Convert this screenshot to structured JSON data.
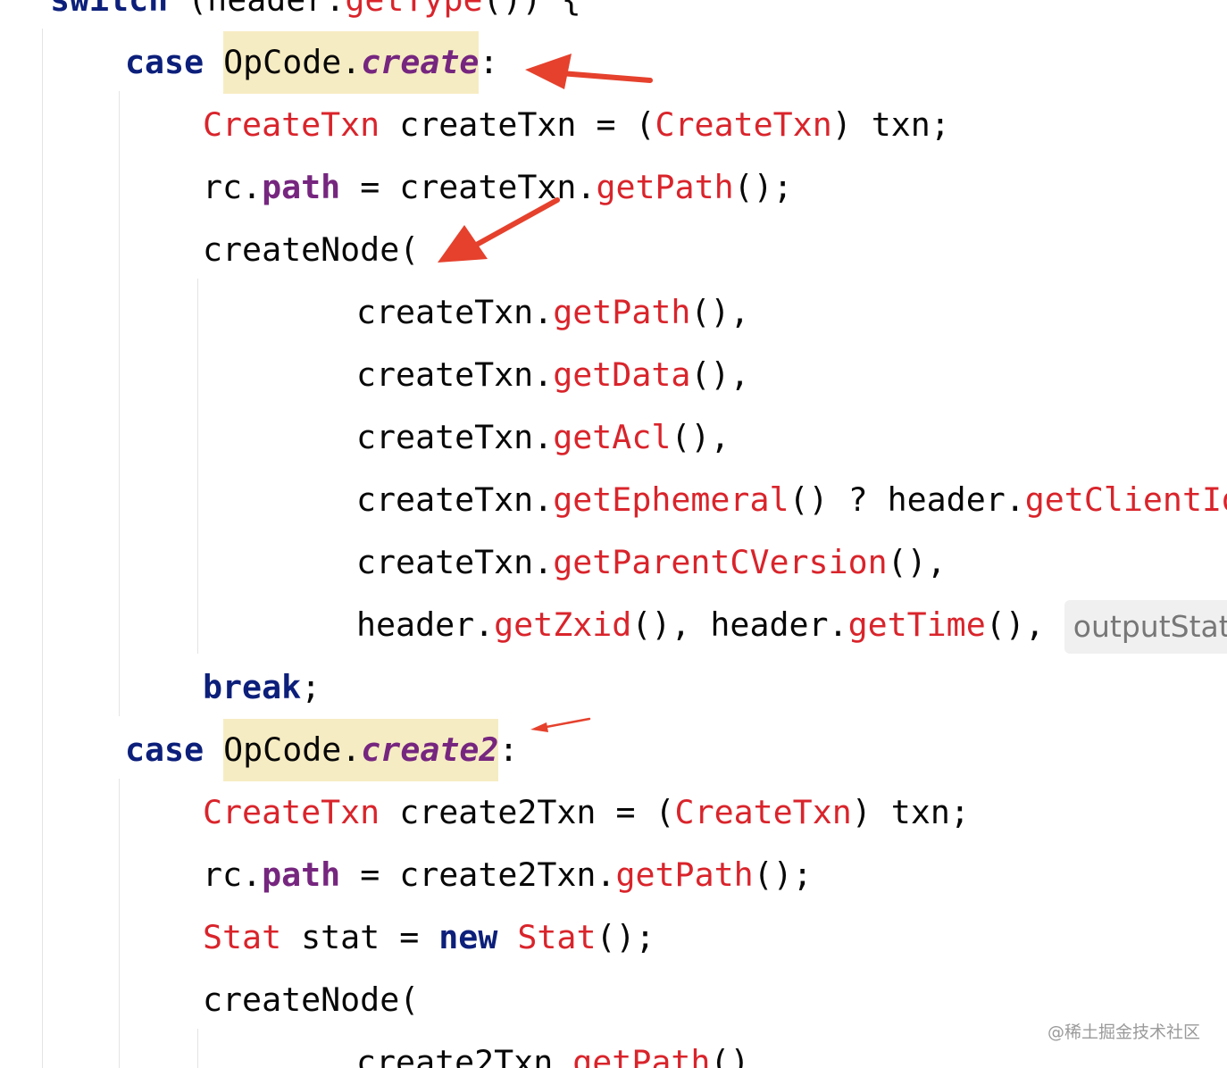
{
  "editor": {
    "lines": [
      {
        "tokens": [
          {
            "t": "switch",
            "c": "kw"
          },
          {
            "t": " (header.",
            "c": ""
          },
          {
            "t": "getType",
            "c": "method"
          },
          {
            "t": "()) {",
            "c": ""
          }
        ]
      },
      {
        "tokens": [
          {
            "t": "case",
            "c": "kw"
          },
          {
            "t": " ",
            "c": ""
          },
          {
            "t": "OpCode.",
            "c": "hl"
          },
          {
            "t": "create",
            "c": "const hl"
          },
          {
            "t": ":",
            "c": ""
          }
        ]
      },
      {
        "tokens": [
          {
            "t": "CreateTxn",
            "c": "type"
          },
          {
            "t": " createTxn = (",
            "c": ""
          },
          {
            "t": "CreateTxn",
            "c": "type"
          },
          {
            "t": ") txn;",
            "c": ""
          }
        ]
      },
      {
        "tokens": [
          {
            "t": "rc.",
            "c": ""
          },
          {
            "t": "path",
            "c": "field"
          },
          {
            "t": " = createTxn.",
            "c": ""
          },
          {
            "t": "getPath",
            "c": "method"
          },
          {
            "t": "();",
            "c": ""
          }
        ]
      },
      {
        "tokens": [
          {
            "t": "createNode(",
            "c": ""
          }
        ]
      },
      {
        "tokens": [
          {
            "t": "createTxn.",
            "c": ""
          },
          {
            "t": "getPath",
            "c": "method"
          },
          {
            "t": "(),",
            "c": ""
          }
        ]
      },
      {
        "tokens": [
          {
            "t": "createTxn.",
            "c": ""
          },
          {
            "t": "getData",
            "c": "method"
          },
          {
            "t": "(),",
            "c": ""
          }
        ]
      },
      {
        "tokens": [
          {
            "t": "createTxn.",
            "c": ""
          },
          {
            "t": "getAcl",
            "c": "method"
          },
          {
            "t": "(),",
            "c": ""
          }
        ]
      },
      {
        "tokens": [
          {
            "t": "createTxn.",
            "c": ""
          },
          {
            "t": "getEphemeral",
            "c": "method"
          },
          {
            "t": "() ? header.",
            "c": ""
          },
          {
            "t": "getClientId",
            "c": "method"
          }
        ]
      },
      {
        "tokens": [
          {
            "t": "createTxn.",
            "c": ""
          },
          {
            "t": "getParentCVersion",
            "c": "method"
          },
          {
            "t": "(),",
            "c": ""
          }
        ]
      },
      {
        "tokens": [
          {
            "t": "header.",
            "c": ""
          },
          {
            "t": "getZxid",
            "c": "method"
          },
          {
            "t": "(), header.",
            "c": ""
          },
          {
            "t": "getTime",
            "c": "method"
          },
          {
            "t": "(),",
            "c": ""
          },
          {
            "t": "outputStat:",
            "c": "hint"
          }
        ]
      },
      {
        "tokens": [
          {
            "t": "break",
            "c": "kw"
          },
          {
            "t": ";",
            "c": ""
          }
        ]
      },
      {
        "tokens": [
          {
            "t": "case",
            "c": "kw"
          },
          {
            "t": " ",
            "c": ""
          },
          {
            "t": "OpCode.",
            "c": "hl"
          },
          {
            "t": "create2",
            "c": "const hl"
          },
          {
            "t": ":",
            "c": ""
          }
        ]
      },
      {
        "tokens": [
          {
            "t": "CreateTxn",
            "c": "type"
          },
          {
            "t": " create2Txn = (",
            "c": ""
          },
          {
            "t": "CreateTxn",
            "c": "type"
          },
          {
            "t": ") txn;",
            "c": ""
          }
        ]
      },
      {
        "tokens": [
          {
            "t": "rc.",
            "c": ""
          },
          {
            "t": "path",
            "c": "field"
          },
          {
            "t": " = create2Txn.",
            "c": ""
          },
          {
            "t": "getPath",
            "c": "method"
          },
          {
            "t": "();",
            "c": ""
          }
        ]
      },
      {
        "tokens": [
          {
            "t": "Stat",
            "c": "type"
          },
          {
            "t": " stat = ",
            "c": ""
          },
          {
            "t": "new",
            "c": "kw"
          },
          {
            "t": " ",
            "c": ""
          },
          {
            "t": "Stat",
            "c": "type"
          },
          {
            "t": "();",
            "c": ""
          }
        ]
      },
      {
        "tokens": [
          {
            "t": "createNode(",
            "c": ""
          }
        ]
      },
      {
        "tokens": [
          {
            "t": "create2Txn.",
            "c": ""
          },
          {
            "t": "getPath",
            "c": "method"
          },
          {
            "t": "(),",
            "c": ""
          }
        ]
      }
    ]
  },
  "watermark": "@稀土掘金技术社区",
  "colors": {
    "keyword": "#0c1f7a",
    "type": "#d9242b",
    "field": "#76267f",
    "highlight": "#f6ecc3",
    "arrow": "#e5412d"
  },
  "annotations": [
    "red-arrow",
    "red-arrow",
    "red-arrow"
  ]
}
